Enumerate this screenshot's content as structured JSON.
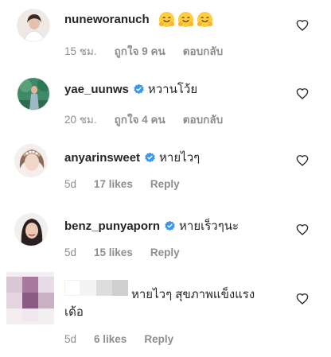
{
  "comments": [
    {
      "username": "nuneworanuch",
      "text": "",
      "emoji": [
        "hugging-face",
        "hugging-face",
        "hugging-face"
      ],
      "verified": false,
      "time": "15 ชม.",
      "likes": "ถูกใจ 9 คน",
      "reply": "ตอบกลับ"
    },
    {
      "username": "yae_uunws",
      "text": "หวานโว้ย",
      "verified": true,
      "time": "20 ชม.",
      "likes": "ถูกใจ 4 คน",
      "reply": "ตอบกลับ"
    },
    {
      "username": "anyarinsweet",
      "text": "หายไวๆ",
      "verified": true,
      "time": "5d",
      "likes": "17 likes",
      "reply": "Reply"
    },
    {
      "username": "benz_punyaporn",
      "text": "หายเร็วๆนะ",
      "verified": true,
      "time": "5d",
      "likes": "15 likes",
      "reply": "Reply"
    },
    {
      "username": "",
      "text_line1": "หายไวๆ สุขภาพแข็งแรง",
      "text_line2": "เด้อ",
      "verified": false,
      "time": "5d",
      "likes": "6 likes",
      "reply": "Reply"
    }
  ],
  "colors": {
    "verified_badge": "#3897f0",
    "meta_text": "#8e8e8e",
    "primary_text": "#262626"
  },
  "icons": {
    "like": "heart-outline-icon",
    "verified": "verified-badge-icon"
  }
}
